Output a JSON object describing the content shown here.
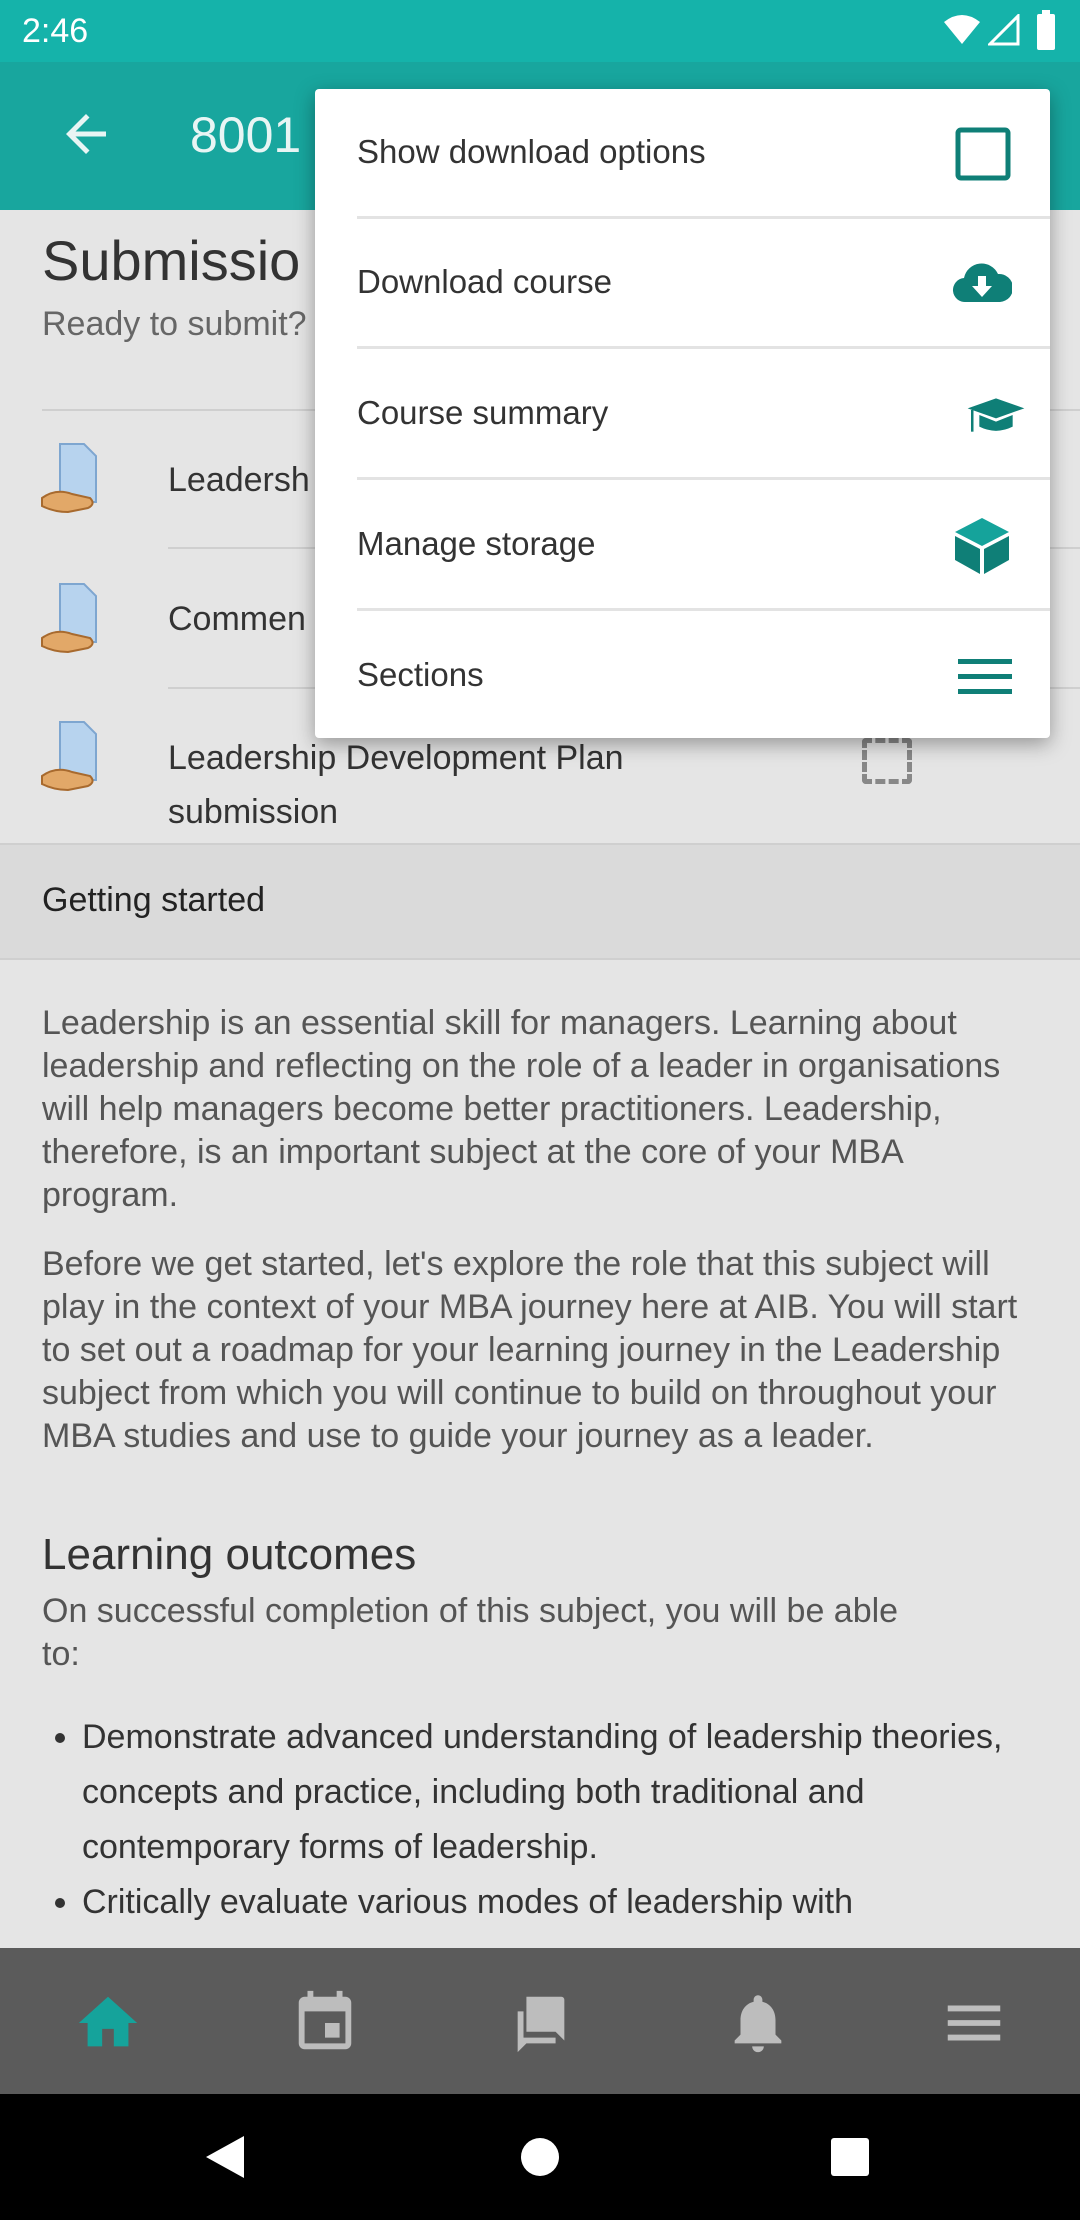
{
  "status_bar": {
    "time": "2:46"
  },
  "app_bar": {
    "title": "8001"
  },
  "section": {
    "title": "Submissio",
    "subtitle": "Ready to submit?"
  },
  "activities": [
    {
      "label": "Leadersh"
    },
    {
      "label": "Commen"
    },
    {
      "label": "Leadership Development Plan submission"
    }
  ],
  "getting_started": {
    "label": "Getting started"
  },
  "paragraphs": [
    "Leadership is an essential skill for managers. Learning about leadership and reflecting on the role of a leader in organisations will help managers become better practitioners. Leadership, therefore, is an important subject at the core of your MBA program.",
    "Before we get started, let's explore the role that this subject will play in the context of your MBA journey here at AIB. You will start to set out a roadmap for your learning journey in the Leadership subject from which you will continue to build on throughout your MBA studies and use to guide your journey as a leader."
  ],
  "learning_outcomes": {
    "title": "Learning outcomes",
    "intro": "On successful completion of this subject, you will be able to:",
    "items": [
      "Demonstrate advanced understanding of leadership theories, concepts and practice, including both traditional and contemporary forms of leadership.",
      "Critically evaluate various modes of leadership with"
    ]
  },
  "menu": {
    "items": [
      {
        "label": "Show download options",
        "icon": "checkbox-icon"
      },
      {
        "label": "Download course",
        "icon": "cloud-download-icon"
      },
      {
        "label": "Course summary",
        "icon": "graduation-cap-icon"
      },
      {
        "label": "Manage storage",
        "icon": "cube-icon"
      },
      {
        "label": "Sections",
        "icon": "menu-icon"
      }
    ]
  },
  "bottom_nav": {
    "items": [
      "home-icon",
      "calendar-icon",
      "messages-icon",
      "notifications-icon",
      "more-menu-icon"
    ],
    "active": "home-icon"
  },
  "colors": {
    "accent": "#15a39b",
    "status_bar": "#15b3aa",
    "bottom_nav": "#5b5b5b",
    "menu_icon": "#0f7f77"
  }
}
